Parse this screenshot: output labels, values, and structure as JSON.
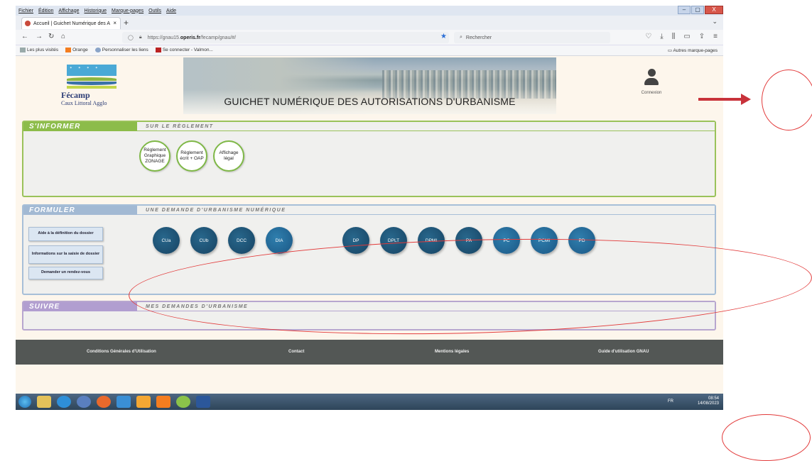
{
  "browser": {
    "menu": [
      "Fichier",
      "Édition",
      "Affichage",
      "Historique",
      "Marque-pages",
      "Outils",
      "Aide"
    ],
    "tab_title": "Accueil | Guichet Numérique des A",
    "tab_close": "×",
    "new_tab": "+",
    "url_prefix": "https://gnau15.",
    "url_domain": "operis.fr",
    "url_path": "/fecamp/gnau/#/",
    "search_placeholder": "Rechercher",
    "bookmarks": [
      "Les plus visités",
      "Orange",
      "Personnaliser les liens",
      "Se connecter - Valmon..."
    ],
    "other_bookmarks": "Autres marque-pages",
    "window_buttons": [
      "–",
      "▢",
      "X"
    ]
  },
  "header": {
    "logo_name": "Fécamp",
    "logo_sub": "Caux Littoral Agglo",
    "title": "GUICHET NUMÉRIQUE DES AUTORISATIONS D'URBANISME",
    "login_label": "Connexion"
  },
  "inform": {
    "tag": "S'INFORMER",
    "subtitle": "SUR LE RÈGLEMENT",
    "buttons": [
      {
        "label": "Règlement Graphique ZONAGE"
      },
      {
        "label": "Règlement écrit + OAP"
      },
      {
        "label": "Affichage légal"
      }
    ]
  },
  "formuler": {
    "tag": "FORMULER",
    "subtitle": "UNE DEMANDE D'URBANISME NUMÉRIQUE",
    "side_buttons": [
      "Aide à la définition du dossier",
      "Informations sur la saisie de dossier",
      "Demander un rendez-vous"
    ],
    "group1": [
      "CUa",
      "CUb",
      "DCC",
      "DIA"
    ],
    "group2": [
      "DP",
      "DPLT",
      "DPMI",
      "PA",
      "PC",
      "PCMI",
      "PD"
    ]
  },
  "suivre": {
    "tag": "SUIVRE",
    "subtitle": "MES DEMANDES D'URBANISME"
  },
  "footer": {
    "links": [
      "Conditions Générales d'Utilisation",
      "Contact",
      "Mentions légales",
      "Guide d'utilisation GNAU"
    ]
  },
  "taskbar": {
    "lang": "FR",
    "time": "08:54",
    "date": "14/08/2023"
  },
  "colors": {
    "inform": "#8cbc4a",
    "formuler": "#a2b9d3",
    "suivre": "#b19ed0",
    "circle_blue": "#1c4e6f",
    "annotation_red": "#e23a3a"
  }
}
